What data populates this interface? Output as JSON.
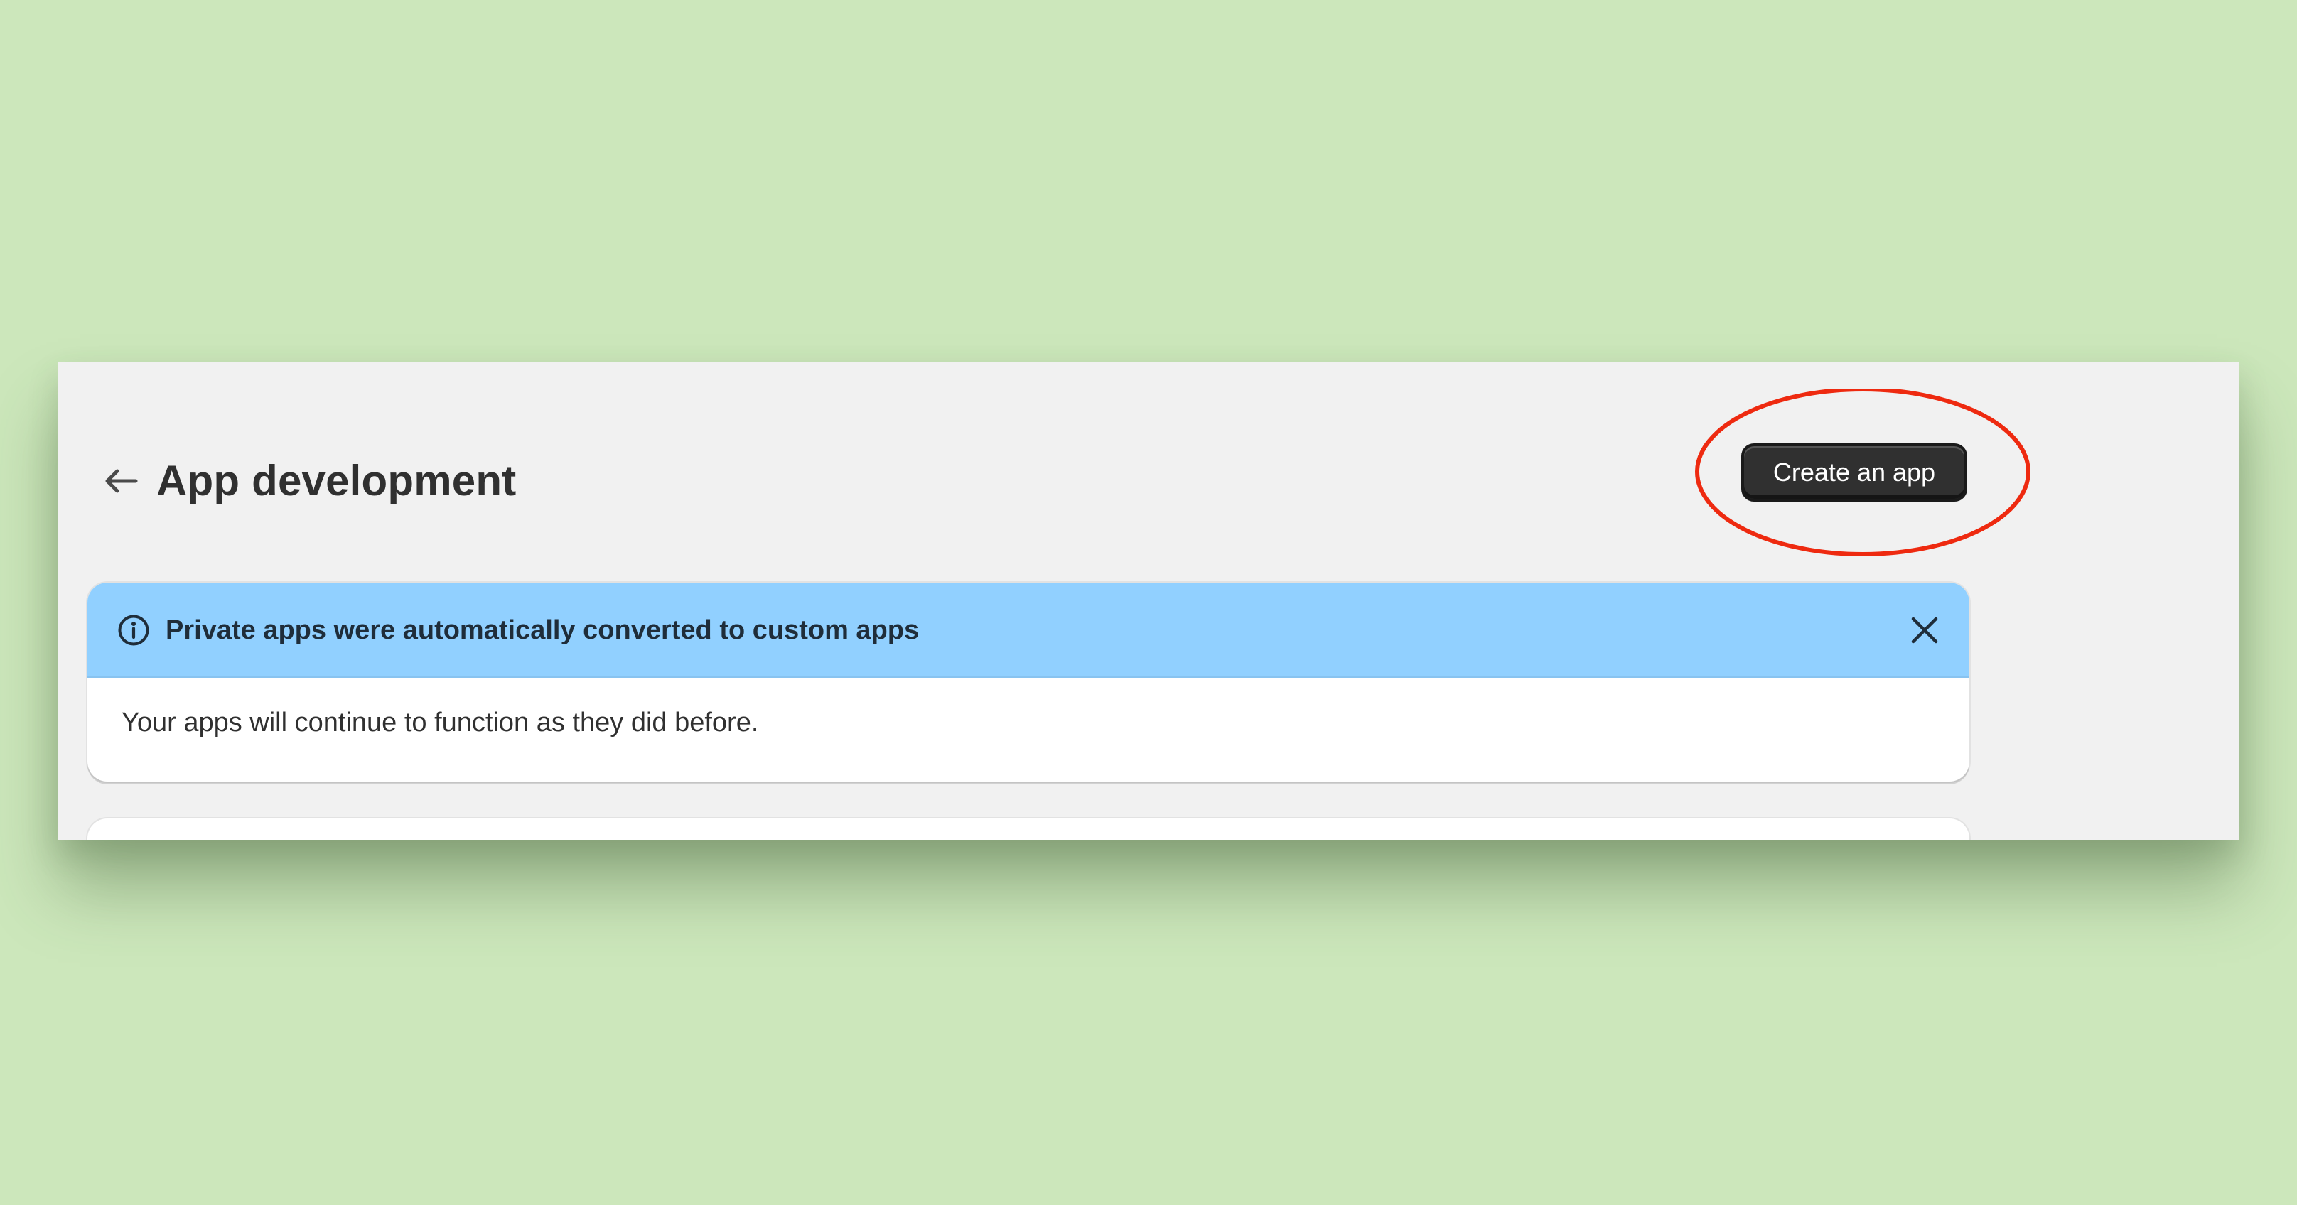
{
  "header": {
    "back_label": "Back",
    "title": "App development",
    "primary_action_label": "Create an app"
  },
  "banner": {
    "icon": "info-icon",
    "title": "Private apps were automatically converted to custom apps",
    "body": "Your apps will continue to function as they did before.",
    "dismiss_icon": "close-icon",
    "status_color": "#91d0ff"
  },
  "annotation": {
    "shape": "ellipse",
    "color": "#ee2a10"
  },
  "colors": {
    "background": "#cce7bb",
    "panel": "#f1f1f1",
    "primary_button": "#303030"
  }
}
